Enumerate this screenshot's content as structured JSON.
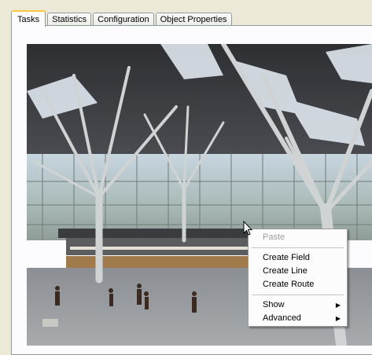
{
  "tabs": [
    {
      "label": "Tasks",
      "active": true
    },
    {
      "label": "Statistics",
      "active": false
    },
    {
      "label": "Configuration",
      "active": false
    },
    {
      "label": "Object Properties",
      "active": false
    }
  ],
  "context_menu": {
    "paste": "Paste",
    "create_field": "Create Field",
    "create_line": "Create Line",
    "create_route": "Create Route",
    "show": "Show",
    "advanced": "Advanced"
  },
  "colors": {
    "active_tab_accent": "#ffc73c",
    "panel_bg": "#fcfcfe",
    "window_bg": "#ece9d8"
  },
  "icons": {
    "cursor": "mouse-pointer-icon",
    "submenu": "submenu-arrow-icon"
  }
}
